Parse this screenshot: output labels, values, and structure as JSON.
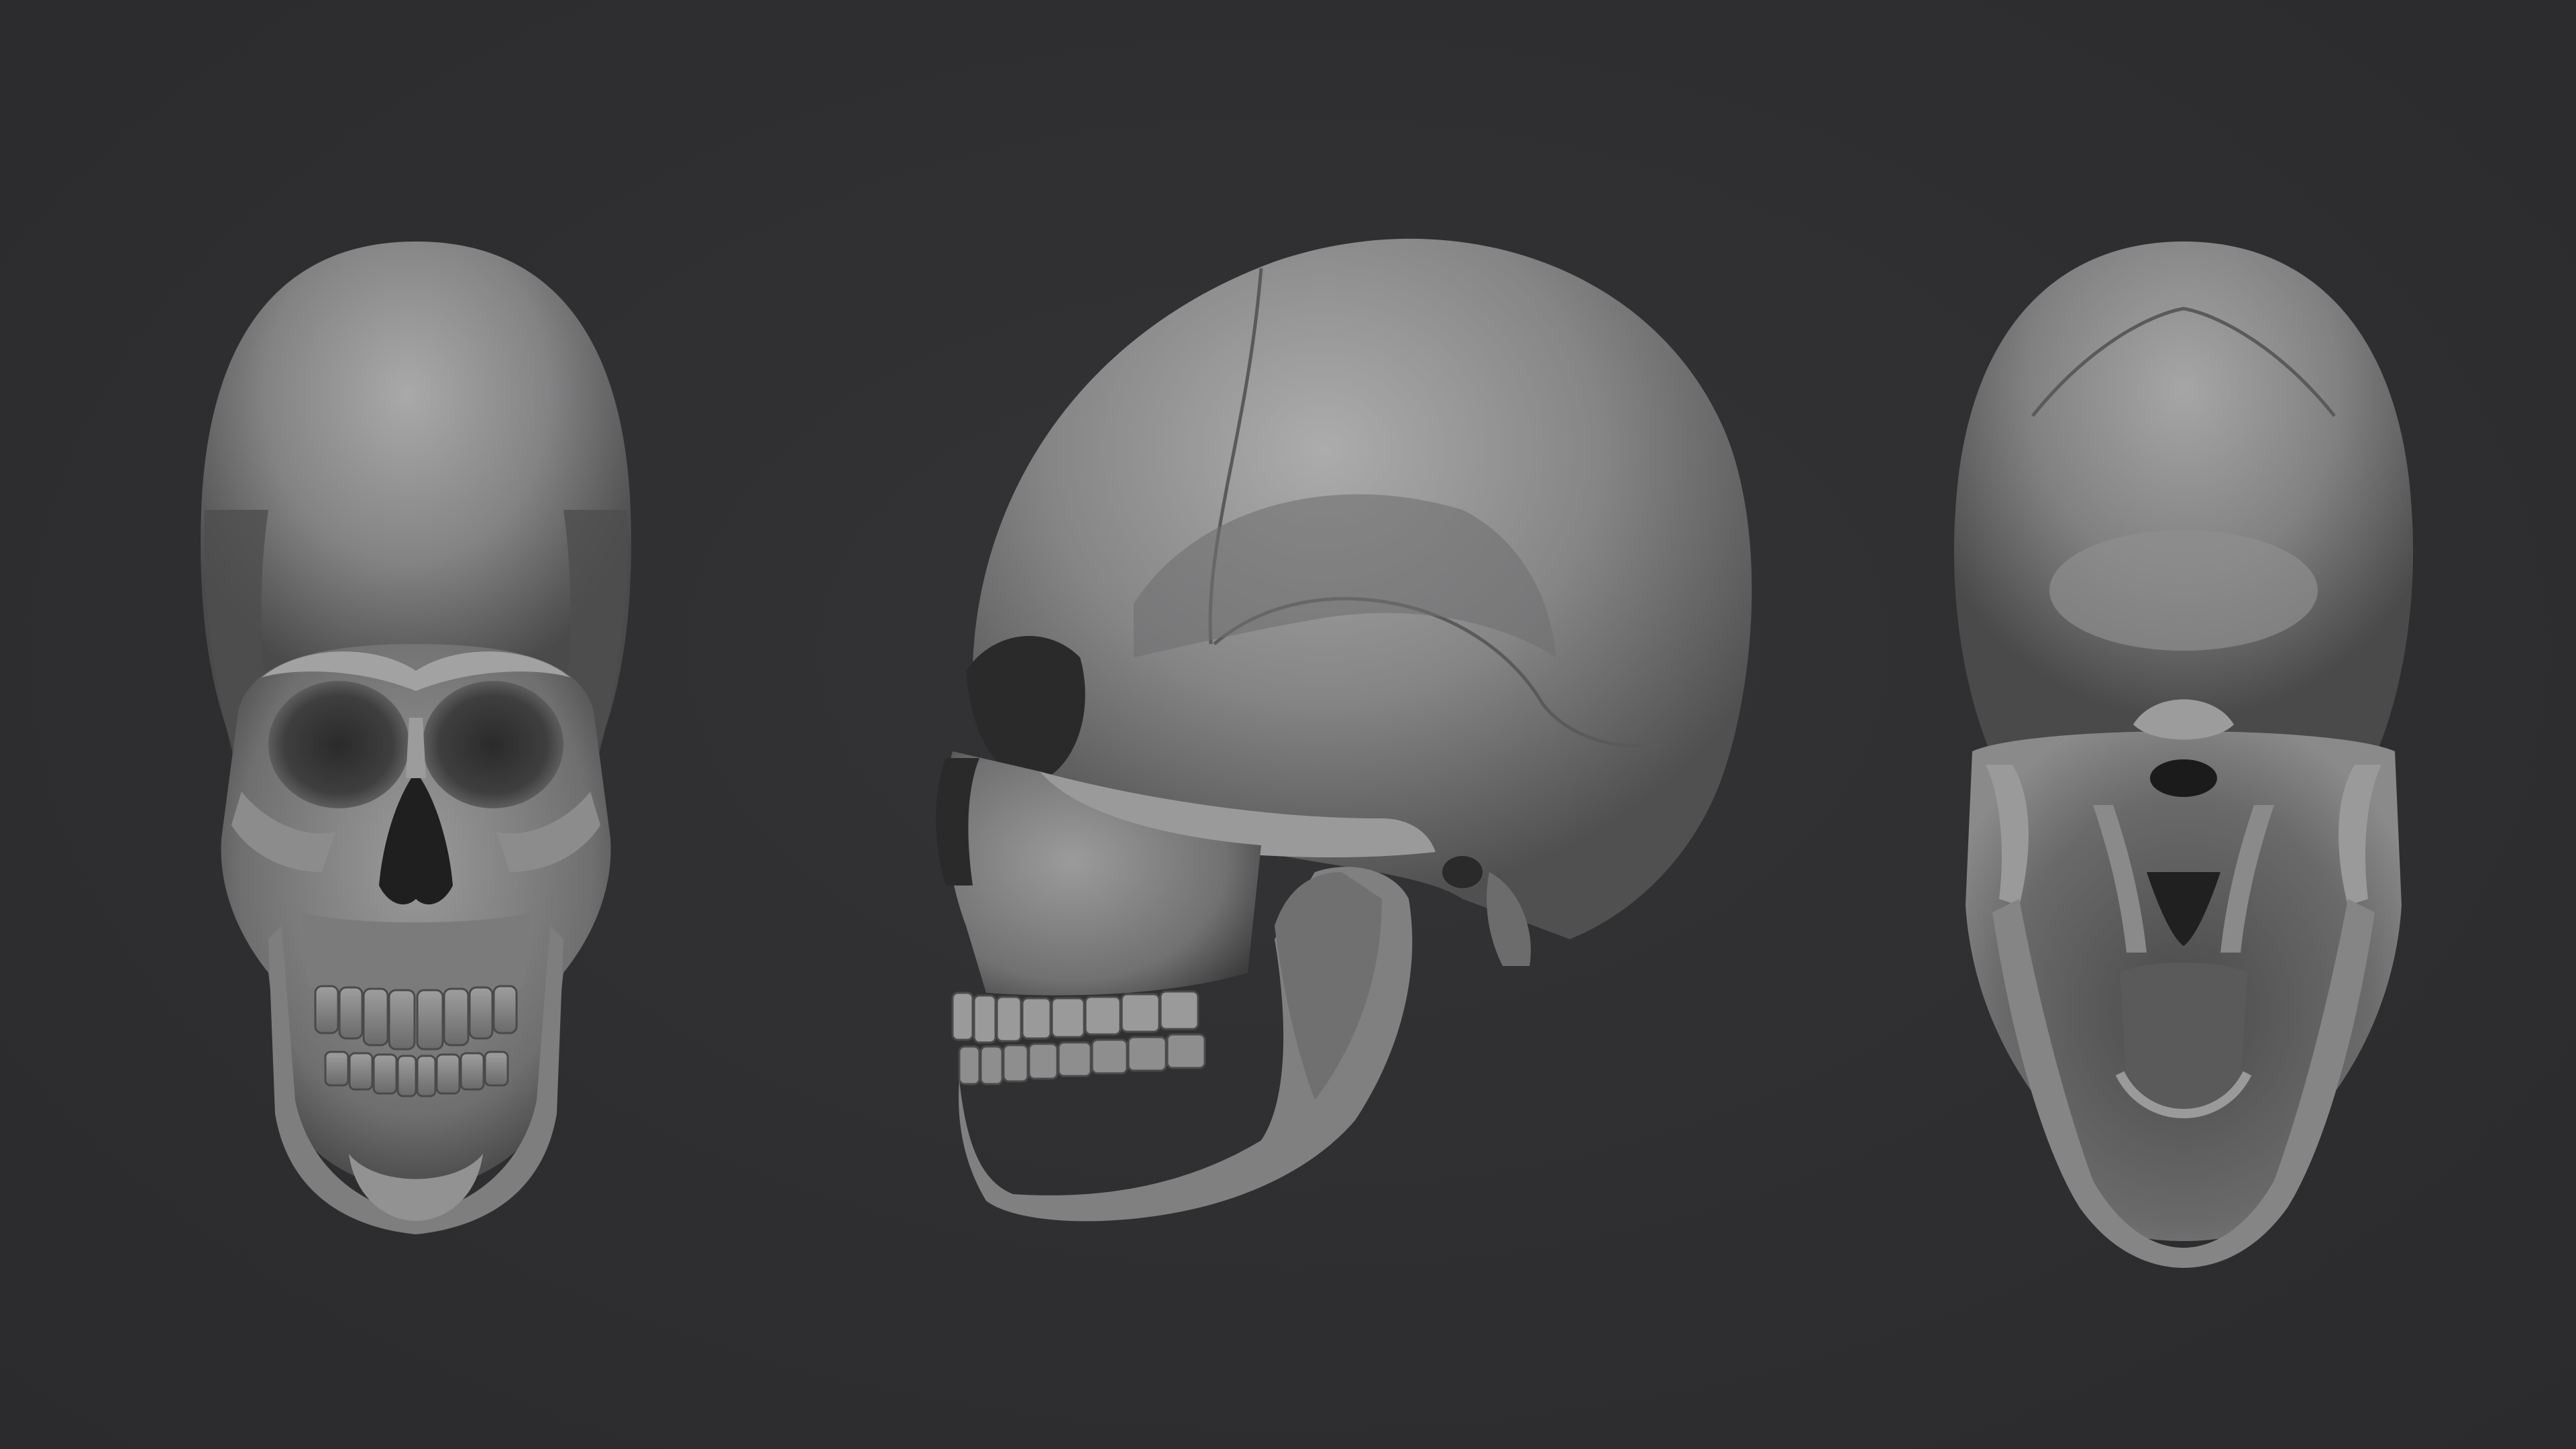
{
  "scene": {
    "background_color": "#2f2f31",
    "bone_base_color": "#8a8a8a",
    "bone_highlight_color": "#b4b4b4",
    "bone_shadow_color": "#3a3a3b",
    "cavity_color": "#1e1e1f"
  },
  "views": [
    {
      "name": "front-view",
      "depicts": "skull-anterior"
    },
    {
      "name": "side-view",
      "depicts": "skull-lateral"
    },
    {
      "name": "base-view",
      "depicts": "skull-inferior"
    }
  ]
}
